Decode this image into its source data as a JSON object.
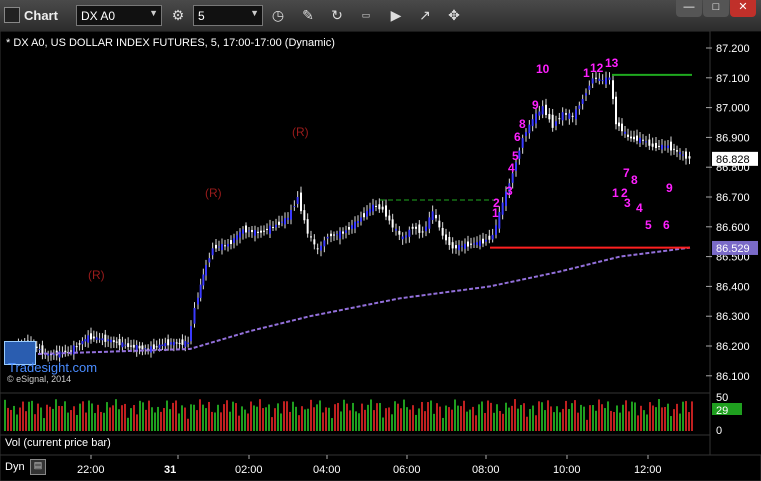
{
  "window": {
    "title": "Chart",
    "symbol": "DX A0",
    "interval": "5"
  },
  "chart": {
    "title_line": "* DX A0, US DOLLAR INDEX FUTURES, 5, 17:00-17:00 (Dynamic)",
    "price_axis": [
      "87.200",
      "87.100",
      "87.000",
      "86.900",
      "86.800",
      "86.700",
      "86.600",
      "86.500",
      "86.400",
      "86.300",
      "86.200",
      "86.100"
    ],
    "current_price": "86.828",
    "ma_price": "86.529",
    "time_axis": [
      "22:00",
      "31",
      "02:00",
      "04:00",
      "06:00",
      "08:00",
      "10:00",
      "12:00"
    ],
    "volume_axis": [
      "50",
      "29",
      "0"
    ],
    "volume_label": "Vol (current price bar)",
    "bottom_label": "Dyn",
    "branding": {
      "logo_text": "Tradesight.com",
      "copyright": "© eSignal, 2014"
    },
    "annotations_r": [
      "(R)",
      "(R)",
      "(R)"
    ],
    "count_labels": [
      "10",
      "1",
      "12",
      "13",
      "9",
      "8",
      "6",
      "4",
      "5",
      "3",
      "2",
      "1",
      "1",
      "2",
      "3",
      "4",
      "5",
      "6",
      "9",
      "7",
      "8"
    ],
    "colors": {
      "up": "#3a3aff",
      "down": "#ffffff",
      "ma": "#9370db",
      "support": "#ff2020",
      "resistance": "#1faa1f",
      "magenta": "#ff20ff",
      "green_count": "#1f9f1f",
      "dark_red": "#9b1b1b"
    }
  }
}
